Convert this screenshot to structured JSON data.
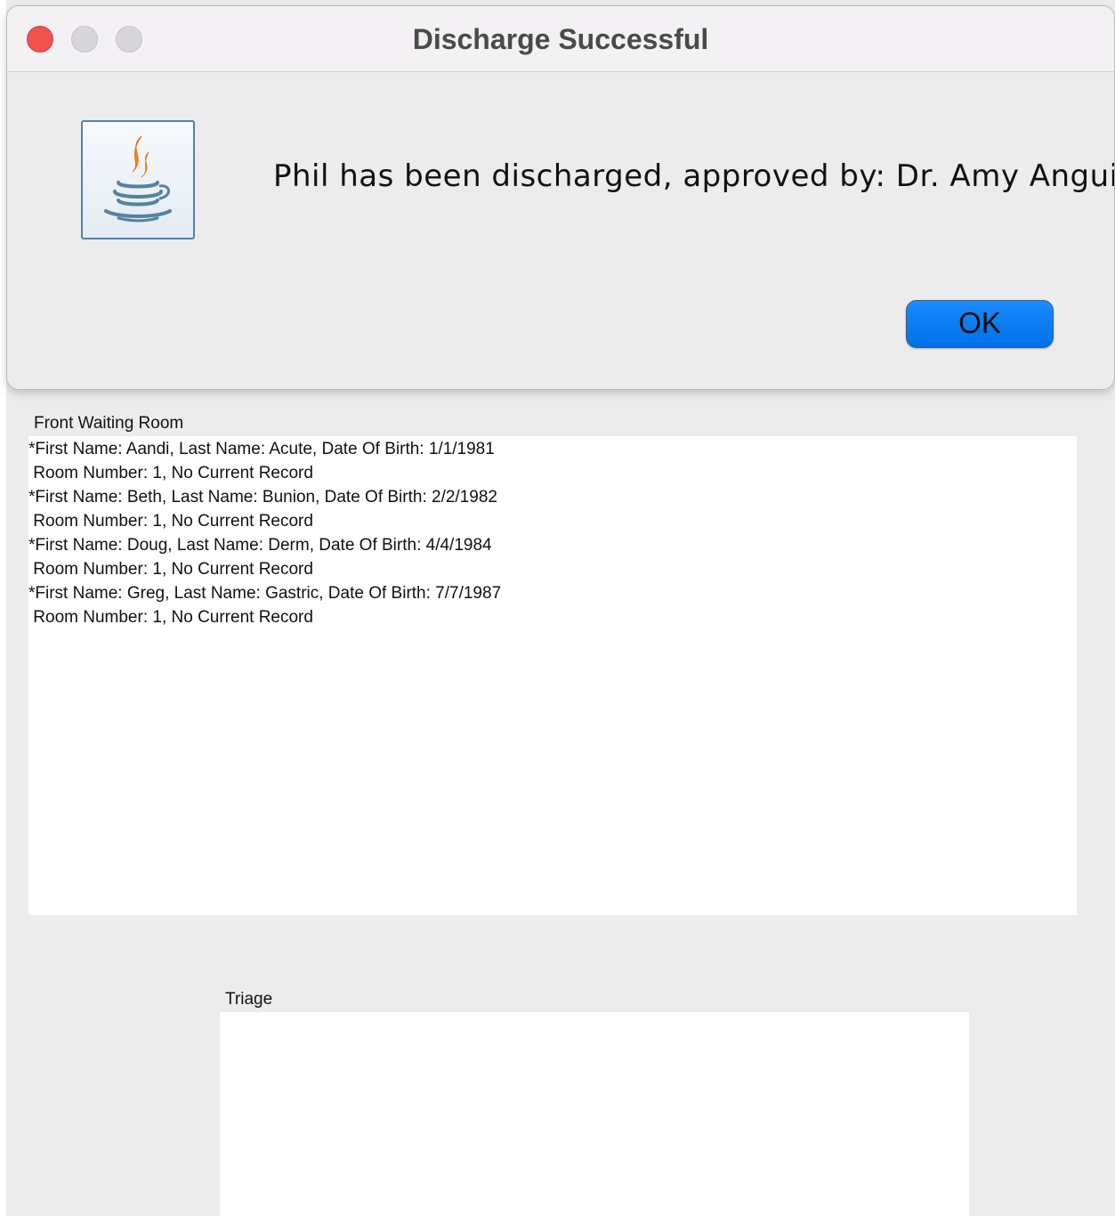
{
  "dialog": {
    "title": "Discharge Successful",
    "message": "Phil has been discharged, approved by: Dr. Amy Anguish",
    "ok_label": "OK",
    "icon": "java-coffee-cup-icon"
  },
  "front_waiting_room": {
    "label": "Front Waiting Room",
    "lines": [
      "*First Name: Aandi, Last Name: Acute, Date Of Birth: 1/1/1981",
      " Room Number: 1, No Current Record",
      "*First Name: Beth, Last Name: Bunion, Date Of Birth: 2/2/1982",
      " Room Number: 1, No Current Record",
      "*First Name: Doug, Last Name: Derm, Date Of Birth: 4/4/1984",
      " Room Number: 1, No Current Record",
      "*First Name: Greg, Last Name: Gastric, Date Of Birth: 7/7/1987",
      " Room Number: 1, No Current Record"
    ]
  },
  "triage": {
    "label": "Triage",
    "lines": []
  },
  "colors": {
    "ok_button": "#0a7cff",
    "close_button": "#f0524d",
    "window_background": "#ececec"
  }
}
